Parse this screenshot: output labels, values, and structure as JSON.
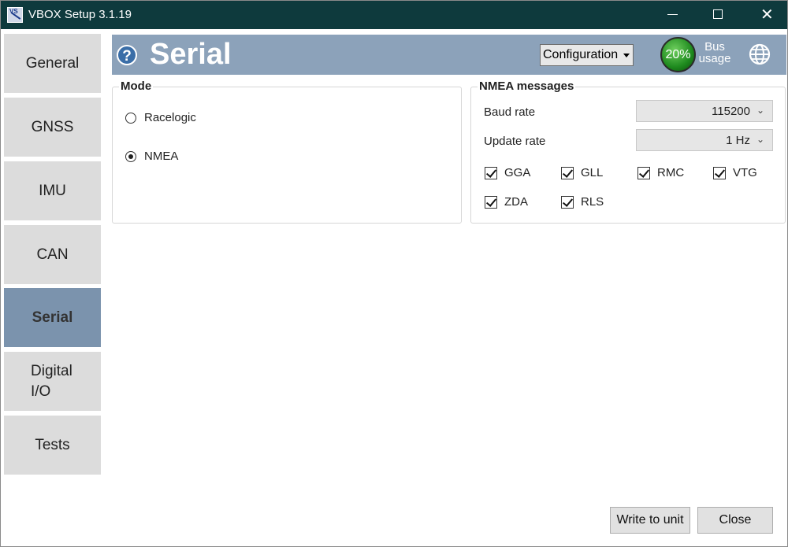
{
  "window": {
    "title": "VBOX Setup 3.1.19"
  },
  "sidebar": {
    "items": [
      {
        "label": "General"
      },
      {
        "label": "GNSS"
      },
      {
        "label": "IMU"
      },
      {
        "label": "CAN"
      },
      {
        "label": "Serial",
        "active": true
      },
      {
        "label_line1": "Digital",
        "label_line2": "I/O"
      },
      {
        "label": "Tests"
      }
    ]
  },
  "header": {
    "title": "Serial",
    "dropdown_value": "Configuration",
    "bus_usage_value": "20%",
    "bus_usage_label_line1": "Bus",
    "bus_usage_label_line2": "usage",
    "color": "#8ca2ba"
  },
  "mode": {
    "label": "Mode",
    "options": [
      {
        "label": "Racelogic",
        "checked": false
      },
      {
        "label": "NMEA",
        "checked": true
      }
    ]
  },
  "nmea": {
    "label": "NMEA messages",
    "baud_rate_label": "Baud rate",
    "baud_rate_value": "115200",
    "update_rate_label": "Update rate",
    "update_rate_value": "1 Hz",
    "messages": [
      {
        "label": "GGA",
        "checked": true
      },
      {
        "label": "GLL",
        "checked": true
      },
      {
        "label": "RMC",
        "checked": true
      },
      {
        "label": "VTG",
        "checked": true
      },
      {
        "label": "ZDA",
        "checked": true
      },
      {
        "label": "RLS",
        "checked": true
      }
    ]
  },
  "footer": {
    "write_label": "Write to unit",
    "close_label": "Close"
  }
}
